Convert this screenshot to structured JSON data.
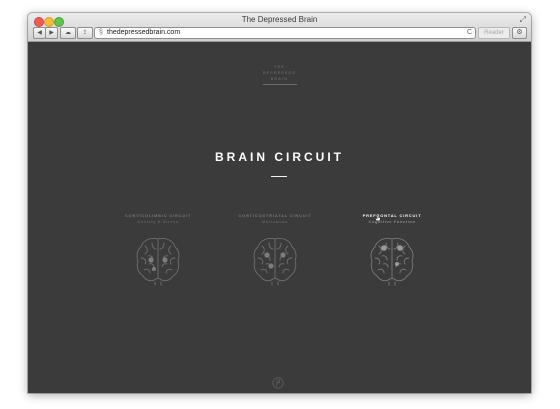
{
  "browser": {
    "title": "The Depressed Brain",
    "url": "thedepressedbrain.com",
    "reader_label": "Reader",
    "back_glyph": "◀",
    "forward_glyph": "▶",
    "cloud_glyph": "☁",
    "share_glyph": "⇪",
    "site_icon_glyph": "§",
    "reload_glyph": "C",
    "settings_glyph": "⚙",
    "resize_glyph": "⤢"
  },
  "page": {
    "logo_lines": [
      "THE",
      "DEPRESSED",
      "BRAIN"
    ],
    "heading": "BRAIN CIRCUIT",
    "circuits": [
      {
        "name": "CORTICOLIMBIC CIRCUIT",
        "subtitle": "Anxiety & Stress",
        "active": false
      },
      {
        "name": "CORTICOSTRIATAL CIRCUIT",
        "subtitle": "Motivation",
        "active": false
      },
      {
        "name": "PREFRONTAL CIRCUIT",
        "subtitle": "Cognitive Function",
        "active": true
      }
    ]
  },
  "colors": {
    "background": "#3b3b3b",
    "heading": "#ffffff",
    "inactive_text": "#777777",
    "brain_stroke": "#6f6f6f"
  },
  "icons": {
    "brain": "brain-icon",
    "footer": "footer-logo-icon"
  }
}
